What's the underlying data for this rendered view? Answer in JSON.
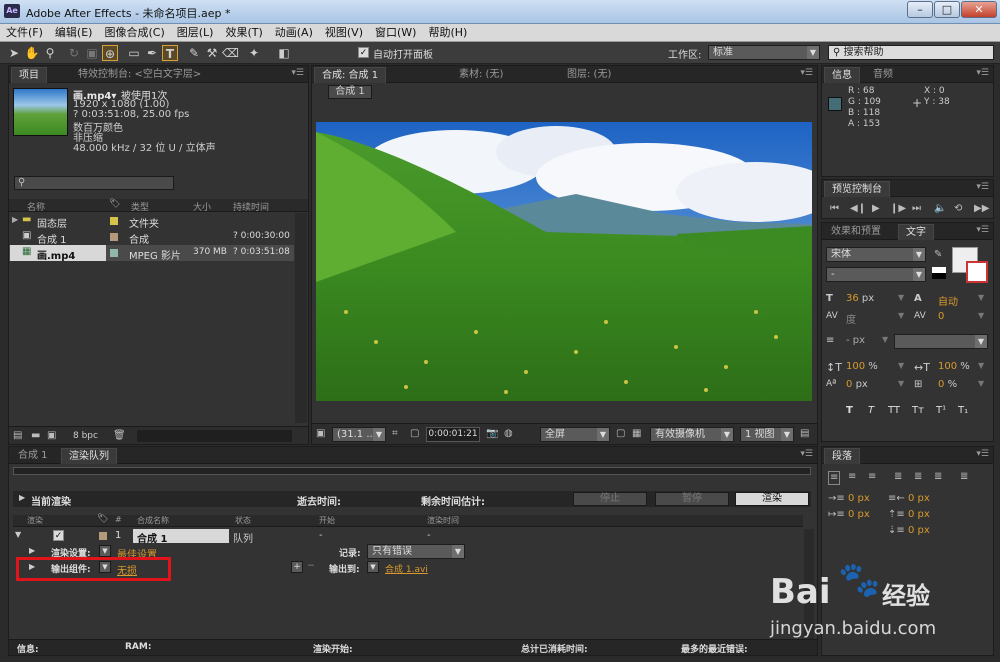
{
  "window": {
    "title": "Adobe After Effects - 未命名项目.aep *",
    "app_icon": "Ae"
  },
  "menu": [
    "文件(F)",
    "编辑(E)",
    "图像合成(C)",
    "图层(L)",
    "效果(T)",
    "动画(A)",
    "视图(V)",
    "窗口(W)",
    "帮助(H)"
  ],
  "toolbar": {
    "auto_open_label": "自动打开面板",
    "workspace_label": "工作区:",
    "workspace_value": "标准",
    "search_placeholder": "搜索帮助"
  },
  "project_panel": {
    "tab_project": "项目",
    "tab_effects": "特效控制台: <空白文字层>",
    "footage_name": "画.mp4▾",
    "used_text": "被使用1次",
    "info_lines": [
      "1920 x 1080 (1.00)",
      "? 0:03:51:08, 25.00 fps",
      "数百万颜色",
      "非压缩",
      "48.000 kHz / 32 位 U / 立体声"
    ],
    "columns": [
      "名称",
      "类型",
      "大小",
      "持续时间"
    ],
    "rows": [
      {
        "name": "固态层",
        "type": "文件夹",
        "size": "",
        "duration": "",
        "color": "#d6c34a"
      },
      {
        "name": "合成 1",
        "type": "合成",
        "size": "",
        "duration": "? 0:00:30:00",
        "color": "#b39a7a"
      },
      {
        "name": "画.mp4",
        "type": "MPEG 影片",
        "size": "370 MB",
        "duration": "? 0:03:51:08",
        "color": "#8fb8a8"
      }
    ],
    "bpc": "8 bpc"
  },
  "viewer": {
    "tab_comp": "合成: 合成 1",
    "tab_footage": "素材: (无)",
    "tab_layer": "图层: (无)",
    "comp_button": "合成 1",
    "zoom": "(31.1 ...",
    "timecode": "0:00:01:21",
    "resolution": "全屏",
    "camera": "有效摄像机",
    "views": "1 视图"
  },
  "info_panel": {
    "tab_info": "信息",
    "tab_audio": "音频",
    "r": "R : 68",
    "g": "G : 109",
    "b": "B : 118",
    "a": "A : 153",
    "x": "X : 0",
    "y": "Y : 38",
    "swatch": "#446d76"
  },
  "preview_panel": {
    "tab": "预览控制台"
  },
  "char_panel": {
    "tab_effects": "效果和预置",
    "tab_char": "文字",
    "font": "宋体",
    "style": "-",
    "size": "36",
    "size_unit": "px",
    "leading": "自动",
    "kerning": "度",
    "tracking": "0",
    "stroke": "- px",
    "vscale": "100",
    "hscale": "100",
    "pct": "%",
    "baseline": "0",
    "baseline_unit": "px",
    "tsume": "0",
    "tsume_unit": "%",
    "styles": [
      "T",
      "T",
      "TT",
      "Tт",
      "T¹",
      "T₁"
    ]
  },
  "paragraph_panel": {
    "tab": "段落",
    "values": [
      "0 px",
      "0 px",
      "0 px",
      "0 px",
      "0 px"
    ]
  },
  "render_queue": {
    "tab_comp": "合成 1",
    "tab_queue": "渲染队列",
    "current_render": "当前渲染",
    "elapsed": "逝去时间:",
    "remaining": "剩余时间估计:",
    "stop": "停止",
    "pause": "暂停",
    "render": "渲染",
    "columns": [
      "渲染",
      "#",
      "合成名称",
      "状态",
      "开始",
      "渲染时间"
    ],
    "item_index": "1",
    "item_comp": "合成 1",
    "item_status": "队列",
    "item_start": "-",
    "item_time": "-",
    "render_settings_label": "渲染设置:",
    "render_settings_value": "最佳设置",
    "log_label": "记录:",
    "log_value": "只有错误",
    "output_module_label": "输出组件:",
    "output_module_value": "无损",
    "output_to_label": "输出到:",
    "output_to_value": "合成 1.avi",
    "status_info": "信息:",
    "status_ram": "RAM:",
    "status_started": "渲染开始:",
    "status_total": "总计已消耗时间:",
    "status_errors": "最多的最近错误:"
  },
  "watermark": {
    "brand": "Bai",
    "brand2": "经验",
    "domain": "jingyan.baidu.com"
  }
}
